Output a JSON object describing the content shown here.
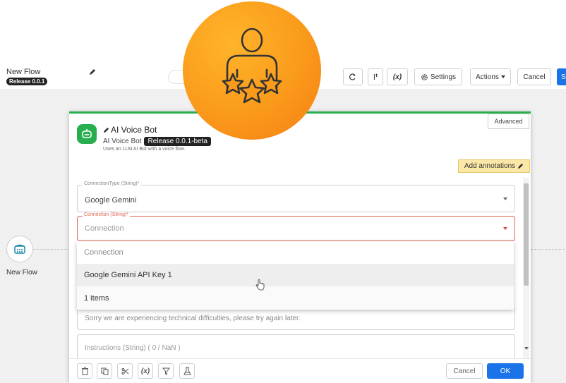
{
  "toolbar": {
    "flow_title": "New Flow",
    "release": "Release 0.0.1",
    "variables_label": "(x)",
    "settings_label": "Settings",
    "actions_label": "Actions",
    "cancel_label": "Cancel",
    "save_label": "S"
  },
  "canvas": {
    "node_label": "New Flow"
  },
  "dialog": {
    "title": "AI Voice Bot",
    "subtitle": "AI Voice Bot",
    "release": "Release 0.0.1-beta",
    "description": "Uses an LLM AI Bot with a voice flow.",
    "advanced_label": "Advanced",
    "annotations_label": "Add annotations",
    "connection_type": {
      "legend": "ConnectionType (String)*",
      "value": "Google Gemini"
    },
    "connection": {
      "legend": "Connection (String)*",
      "placeholder": "Connection"
    },
    "dropdown_options": [
      "Connection",
      "Google Gemini API Key 1",
      "1 items"
    ],
    "message_value": "Sorry we are experiencing technical difficulties, please try again later.",
    "instructions_placeholder": "Instructions (String) ( 0 / NaN )",
    "footer": {
      "variables_label": "(x)",
      "cancel_label": "Cancel",
      "ok_label": "OK"
    }
  },
  "colors": {
    "accent_green": "#27ae4f",
    "primary_blue": "#1a73e8",
    "error_red": "#e0654e",
    "badge_orange": "#fa9a1b",
    "annotation_yellow": "#fbe8a6"
  },
  "icons": [
    "pencil-icon",
    "redo-icon",
    "branch-icon",
    "gear-icon",
    "chevron-down-icon",
    "phone-icon",
    "bot-icon",
    "trash-icon",
    "copy-icon",
    "scissors-icon",
    "filter-icon",
    "flask-icon",
    "hand-cursor-icon",
    "person-stars-icon"
  ]
}
